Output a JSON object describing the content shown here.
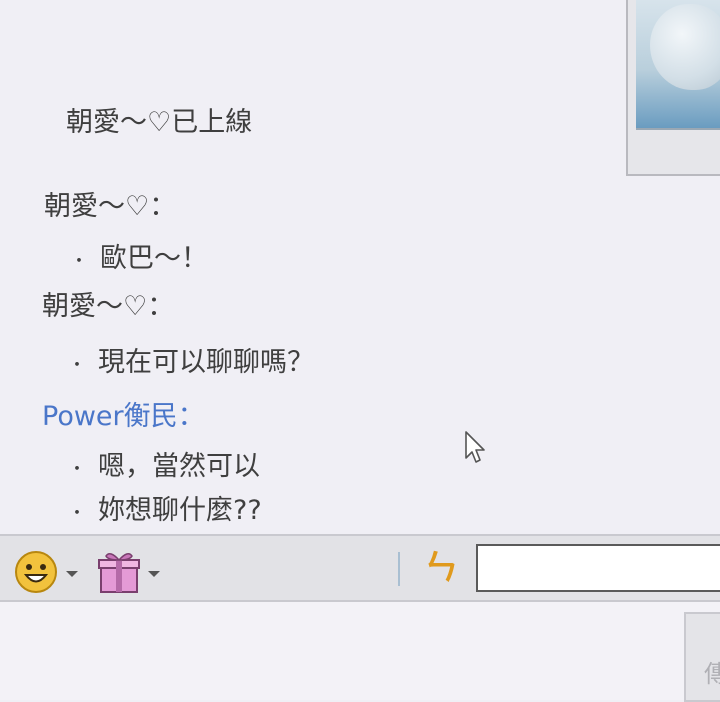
{
  "chat": {
    "status": "朝愛～♡已上線",
    "messages": [
      {
        "sender": "朝愛～♡：",
        "lines": [
          "歐巴～！"
        ],
        "self": false
      },
      {
        "sender": "朝愛～♡：",
        "lines": [
          "現在可以聊聊嗎？"
        ],
        "self": false
      },
      {
        "sender": "Power衡民：",
        "lines": [
          "嗯，當然可以",
          "妳想聊什麼??"
        ],
        "self": true
      }
    ],
    "bullet": "・"
  },
  "toolbar": {
    "icons": [
      "smiley-icon",
      "gift-icon",
      "nudge-icon"
    ],
    "nudge_glyph": "ㄣ",
    "input_value": ""
  },
  "send_button": {
    "label": "傳"
  },
  "colors": {
    "self_name": "#4a76c9",
    "text": "#3f3f3f",
    "toolbar_bg": "#e2e2e6"
  }
}
